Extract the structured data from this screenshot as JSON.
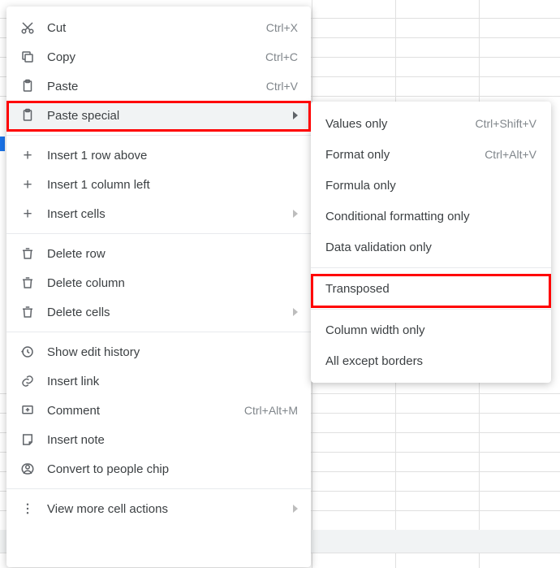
{
  "main_menu": {
    "cut": {
      "label": "Cut",
      "shortcut": "Ctrl+X"
    },
    "copy": {
      "label": "Copy",
      "shortcut": "Ctrl+C"
    },
    "paste": {
      "label": "Paste",
      "shortcut": "Ctrl+V"
    },
    "paste_special": {
      "label": "Paste special"
    },
    "insert_row": {
      "label": "Insert 1 row above"
    },
    "insert_col": {
      "label": "Insert 1 column left"
    },
    "insert_cells": {
      "label": "Insert cells"
    },
    "delete_row": {
      "label": "Delete row"
    },
    "delete_col": {
      "label": "Delete column"
    },
    "delete_cells": {
      "label": "Delete cells"
    },
    "edit_history": {
      "label": "Show edit history"
    },
    "insert_link": {
      "label": "Insert link"
    },
    "comment": {
      "label": "Comment",
      "shortcut": "Ctrl+Alt+M"
    },
    "insert_note": {
      "label": "Insert note"
    },
    "people_chip": {
      "label": "Convert to people chip"
    },
    "more_actions": {
      "label": "View more cell actions"
    }
  },
  "sub_menu": {
    "values_only": {
      "label": "Values only",
      "shortcut": "Ctrl+Shift+V"
    },
    "format_only": {
      "label": "Format only",
      "shortcut": "Ctrl+Alt+V"
    },
    "formula_only": {
      "label": "Formula only"
    },
    "cond_format": {
      "label": "Conditional formatting only"
    },
    "data_validation": {
      "label": "Data validation only"
    },
    "transposed": {
      "label": "Transposed"
    },
    "col_width": {
      "label": "Column width only"
    },
    "except_borders": {
      "label": "All except borders"
    }
  }
}
